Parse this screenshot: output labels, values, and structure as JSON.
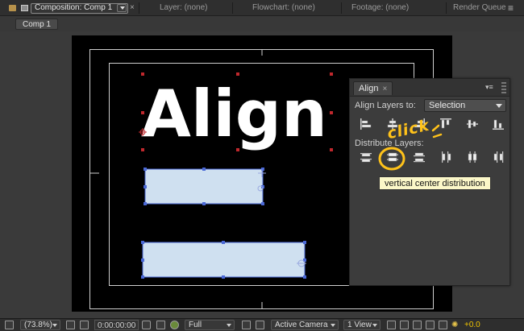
{
  "tabs": {
    "composition": "Composition: Comp 1",
    "layer": "Layer: (none)",
    "flowchart": "Flowchart: (none)",
    "footage": "Footage: (none)",
    "render_queue": "Render Queue"
  },
  "comp_tab": "Comp 1",
  "canvas_text": "Align",
  "align_panel": {
    "title": "Align",
    "align_label": "Align Layers to:",
    "align_to_value": "Selection",
    "distribute_label": "Distribute Layers:",
    "menu_glyph": "▾≡"
  },
  "tooltip": "vertical center distribution",
  "annotation": "click",
  "bottom": {
    "zoom": "(73.8%)",
    "timecode": "0:00:00:00",
    "resolution": "Full",
    "camera": "Active Camera",
    "view": "1 View",
    "exposure": "+0.0"
  },
  "colors": {
    "shape_fill": "#cfe0f0",
    "handle": "#4a68d6",
    "accent": "#ffc21a",
    "anchor": "#c0282d"
  }
}
